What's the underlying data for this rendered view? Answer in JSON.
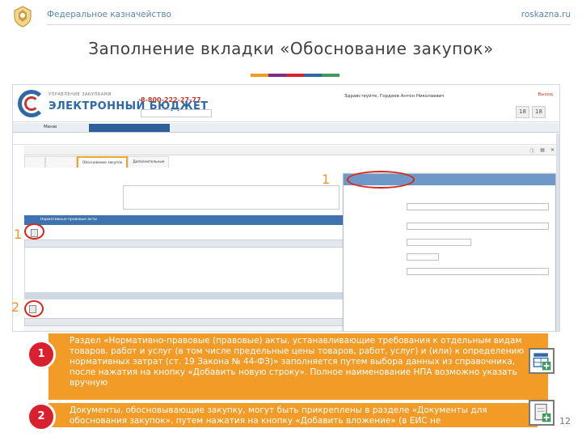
{
  "header": {
    "org": "Федеральное казначейство",
    "site": "roskazna.ru"
  },
  "slide": {
    "title": "Заполнение вкладки «Обоснование закупок»",
    "title_bar_colors": [
      "#f29b26",
      "#7b2d8a",
      "#d8202e",
      "#2e68a8",
      "#3f9b5c"
    ],
    "page_number": "12"
  },
  "app": {
    "logo_small": "УПРАВЛЕНИЕ ЗАКУПКАМИ",
    "logo_big": "ЭЛЕКТРОННЫЙ БЮДЖЕТ",
    "phone": "8-800-222-27-77",
    "user": "Здравствуйте, Гордеев Антон Николаевич",
    "exit": "Выход",
    "menu_home": "Меню",
    "cal_1": "18",
    "cal_2": "18",
    "tab_active": "Обоснование закупок",
    "tab_2": "Нормативные правовые акты",
    "tab_3": "Дополнительные"
  },
  "markers": {
    "m1_top": "1",
    "m1_left": "1",
    "m2_left": "2"
  },
  "callouts": [
    {
      "badge": "1",
      "text": "Раздел «Нормативно-правовые (правовые) акты, устанавливающие требования к отдельным видам товаров, работ и услуг (в том числе предельные цены товаров, работ, услуг) и (или) к определению нормативных затрат (ст. 19 Закона № 44-ФЗ)» заполняется путем выбора данных из справочника, после нажатия на кнопку «Добавить новую строку». Полное наименование НПА возможно указать вручную",
      "icon": "add-row-icon"
    },
    {
      "badge": "2",
      "text": "Документы, обосновывающие закупку, могут быть прикреплены в разделе «Документы для обоснования закупок», путем нажатия на кнопку «Добавить вложение» (в ЕИС не",
      "icon": "add-attachment-icon"
    }
  ]
}
